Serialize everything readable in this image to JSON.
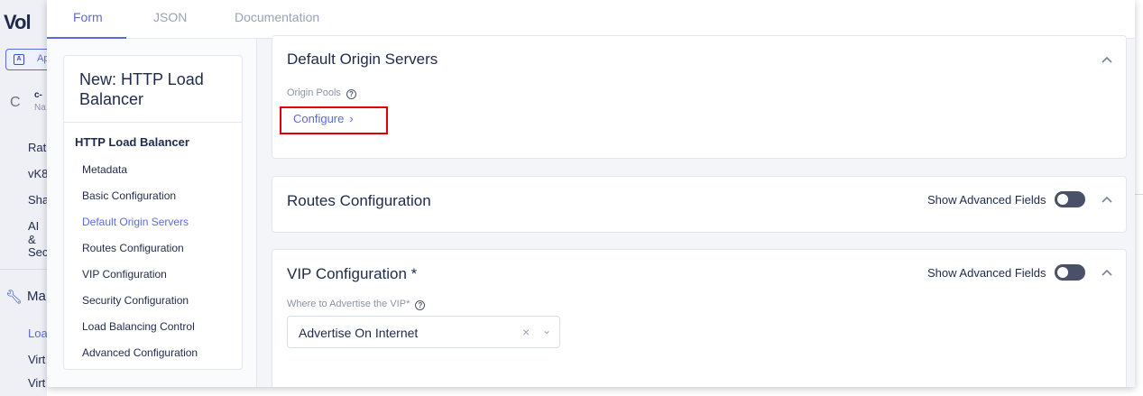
{
  "background_app": {
    "logo": "Vol",
    "app_button": {
      "icon_letter": "A",
      "label": "Ap"
    },
    "context_initial": "C",
    "context_line1": "c-",
    "context_line2": "Na",
    "items": [
      "Rat",
      "vK8",
      "Sha",
      "AI &",
      "Sec"
    ],
    "section": "Ma",
    "sub_items": [
      "Loa",
      "Virt",
      "Virt"
    ]
  },
  "tabs": [
    "Form",
    "JSON",
    "Documentation"
  ],
  "active_tab": "Form",
  "nav": {
    "title": "New: HTTP Load Balancer",
    "heading": "HTTP Load Balancer",
    "items": [
      "Metadata",
      "Basic Configuration",
      "Default Origin Servers",
      "Routes Configuration",
      "VIP Configuration",
      "Security Configuration",
      "Load Balancing Control",
      "Advanced Configuration"
    ],
    "active_item": "Default Origin Servers"
  },
  "sections": {
    "origin": {
      "title": "Default Origin Servers",
      "field_label": "Origin Pools",
      "action": "Configure",
      "action_arrow": "›"
    },
    "routes": {
      "title": "Routes Configuration",
      "advanced_label": "Show Advanced Fields",
      "advanced_on": false
    },
    "vip": {
      "title": "VIP Configuration *",
      "advanced_label": "Show Advanced Fields",
      "advanced_on": false,
      "field_label": "Where to Advertise the VIP*",
      "select_value": "Advertise On Internet"
    }
  },
  "icons": {
    "help": "?",
    "clear": "×",
    "dropdown": "⌄",
    "collapse": "chevron-up-icon"
  },
  "colors": {
    "accent": "#5b6bd9",
    "highlight": "#e00000",
    "toggle_off": "#4a5068"
  }
}
